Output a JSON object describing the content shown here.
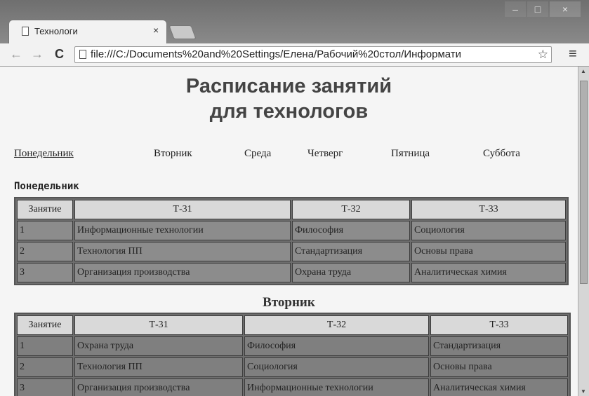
{
  "browser": {
    "tab_title": "Технологи",
    "tab_close": "×",
    "address": "file:///C:/Documents%20and%20Settings/Елена/Рабочий%20стол/Информати",
    "window_controls": [
      "‒",
      "□",
      "×"
    ]
  },
  "page": {
    "title_line1": "Расписание занятий",
    "title_line2": "для технологов",
    "days": [
      "Понедельник",
      "Вторник",
      "Среда",
      "Четверг",
      "Пятница",
      "Суббота"
    ],
    "active_day": "Понедельник"
  },
  "monday": {
    "heading": "Понедельник",
    "headers": [
      "Занятие",
      "Т-31",
      "Т-32",
      "Т-33"
    ],
    "rows": [
      [
        "1",
        "Информационные технологии",
        "Философия",
        "Социология"
      ],
      [
        "2",
        "Технология ПП",
        "Стандартизация",
        "Основы права"
      ],
      [
        "3",
        "Организация производства",
        "Охрана труда",
        "Аналитическая химия"
      ]
    ]
  },
  "tuesday": {
    "heading": "Вторник",
    "headers": [
      "Занятие",
      "Т-31",
      "Т-32",
      "Т-33"
    ],
    "rows": [
      [
        "1",
        "Охрана труда",
        "Философия",
        "Стандартизация"
      ],
      [
        "2",
        "Технология ПП",
        "Социология",
        "Основы права"
      ],
      [
        "3",
        "Организация производства",
        "Информационные технологии",
        "Аналитическая химия"
      ]
    ]
  }
}
